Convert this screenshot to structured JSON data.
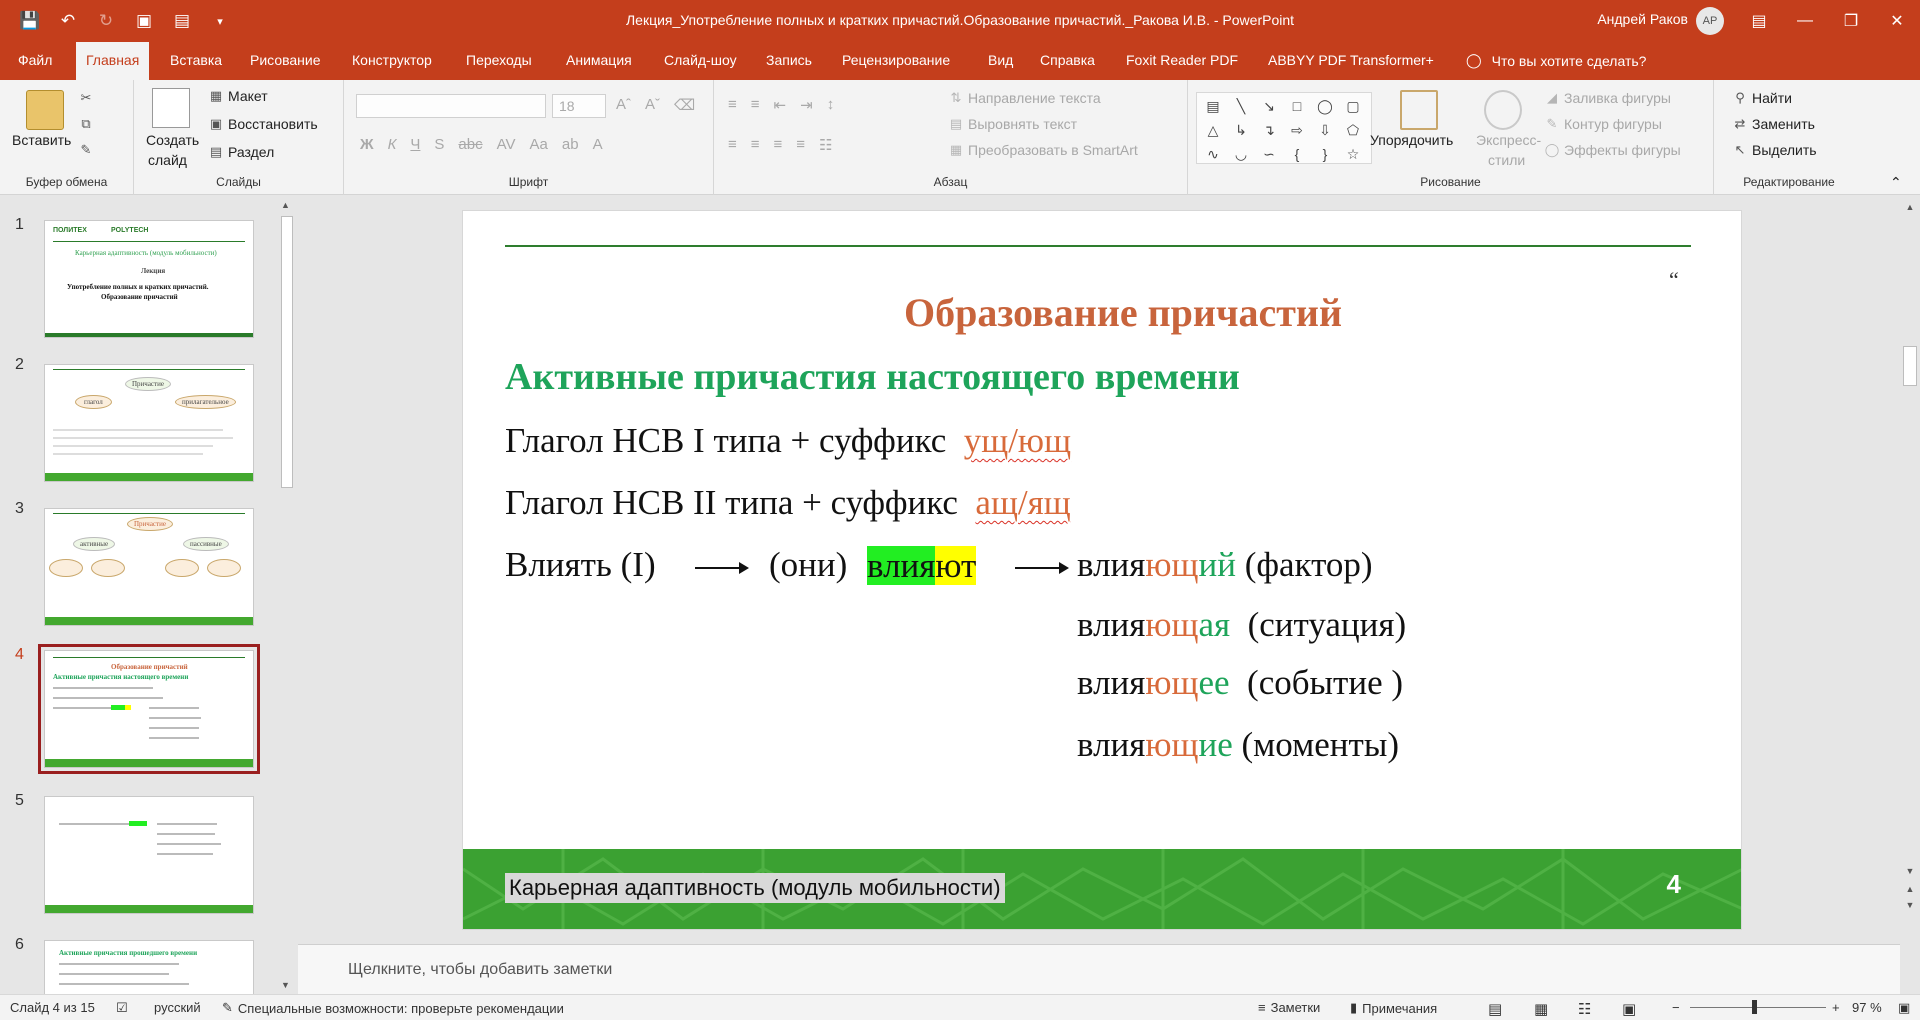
{
  "window": {
    "title": "Лекция_Употребление полных и кратких причастий.Образование причастий._Ракова И.В.  -  PowerPoint",
    "user": "Андрей Раков",
    "avatar": "АР"
  },
  "ribbon_tabs": [
    "Файл",
    "Главная",
    "Вставка",
    "Рисование",
    "Конструктор",
    "Переходы",
    "Анимация",
    "Слайд-шоу",
    "Запись",
    "Рецензирование",
    "Вид",
    "Справка",
    "Foxit Reader PDF",
    "ABBYY PDF Transformer+"
  ],
  "active_tab": "Главная",
  "tell_me": "Что вы хотите сделать?",
  "ribbon": {
    "clipboard": {
      "paste": "Вставить",
      "label": "Буфер обмена"
    },
    "slides": {
      "create": "Создать",
      "create2": "слайд",
      "layout": "Макет",
      "reset": "Восстановить",
      "section": "Раздел",
      "label": "Слайды"
    },
    "font": {
      "size": "18",
      "label": "Шрифт"
    },
    "paragraph": {
      "text_direction": "Направление текста",
      "align_text": "Выровнять текст",
      "smartart": "Преобразовать в SmartArt",
      "label": "Абзац"
    },
    "drawing": {
      "arrange": "Упорядочить",
      "quick_styles": "Экспресс-",
      "quick_styles2": "стили",
      "fill": "Заливка фигуры",
      "outline": "Контур фигуры",
      "effects": "Эффекты фигуры",
      "label": "Рисование"
    },
    "editing": {
      "find": "Найти",
      "replace": "Заменить",
      "select": "Выделить",
      "label": "Редактирование"
    }
  },
  "thumbnails": [
    {
      "num": "1",
      "top_left": "ПОЛИТЕХ",
      "top_right": "POLYTECH",
      "line1": "Карьерная адаптивность (модуль мобильности)",
      "line2": "Лекция",
      "line3": "Употребление полных и кратких причастий.",
      "line4": "Образование причастий"
    },
    {
      "num": "2",
      "center": "Причастие",
      "left": "глагол",
      "right": "прилагательное"
    },
    {
      "num": "3",
      "center": "Причастие",
      "left": "активные",
      "right": "пассивные"
    },
    {
      "num": "4",
      "title": "Образование причастий",
      "subtitle": "Активные причастия настоящего времени"
    },
    {
      "num": "5"
    },
    {
      "num": "6",
      "title": "Активные причастия прошедшего времени"
    }
  ],
  "selected_slide": "4",
  "slide": {
    "title": "Образование причастий",
    "quote_mark": "“",
    "subtitle": "Активные причастия настоящего времени",
    "rule1_prefix": "Глагол НСВ I типа + суффикс",
    "rule1_suffix": "ущ/ющ",
    "rule2_prefix": "Глагол НСВ II типа + суффикс",
    "rule2_suffix": "ащ/ящ",
    "example_verb": "Влиять  (I)",
    "example_they": "(они)",
    "example_stem": "влия",
    "example_ending": "ют",
    "forms": [
      {
        "stem": "влия",
        "suffix": "ющ",
        "ending": "ий",
        "noun": "(фактор)"
      },
      {
        "stem": "влия",
        "suffix": "ющ",
        "ending": "ая",
        "noun": "(ситуация)"
      },
      {
        "stem": "влия",
        "suffix": "ющ",
        "ending": "ее",
        "noun": "(событие )"
      },
      {
        "stem": "влия",
        "suffix": "ющ",
        "ending": "ие",
        "noun": "(моменты)"
      }
    ],
    "footer": "Карьерная адаптивность (модуль мобильности)",
    "page_number": "4",
    "colors": {
      "title": "#c8643c",
      "subtitle": "#1ea45a",
      "footer": "#3ba132"
    }
  },
  "notes_placeholder": "Щелкните, чтобы добавить заметки",
  "status": {
    "slide_of": "Слайд 4 из 15",
    "language": "русский",
    "accessibility": "Специальные возможности: проверьте рекомендации",
    "notes": "Заметки",
    "comments": "Примечания",
    "zoom": "97 %"
  }
}
